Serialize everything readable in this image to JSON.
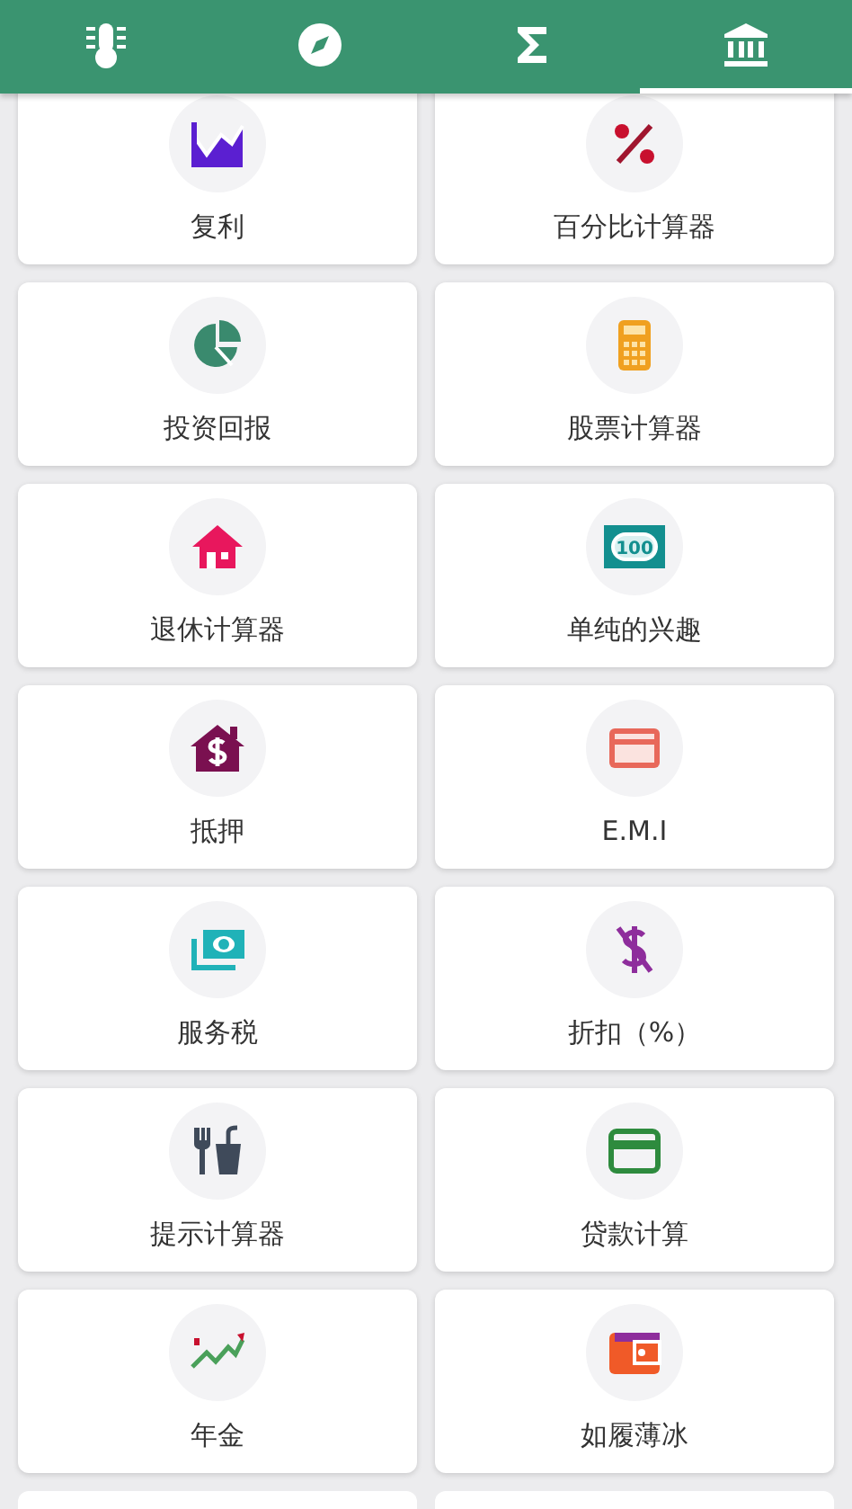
{
  "tabs": [
    {
      "kind": "thermometer",
      "selected": false
    },
    {
      "kind": "compass",
      "selected": false
    },
    {
      "kind": "sigma",
      "selected": false
    },
    {
      "kind": "bank",
      "selected": true
    }
  ],
  "calculators": [
    {
      "label": "复利",
      "kind": "area-chart"
    },
    {
      "label": "百分比计算器",
      "kind": "percent"
    },
    {
      "label": "投资回报",
      "kind": "pie"
    },
    {
      "label": "股票计算器",
      "kind": "calculator"
    },
    {
      "label": "退休计算器",
      "kind": "house"
    },
    {
      "label": "单纯的兴趣",
      "kind": "banknote"
    },
    {
      "label": "抵押",
      "kind": "house-dollar"
    },
    {
      "label": "E.M.I",
      "kind": "card-salmon"
    },
    {
      "label": "服务税",
      "kind": "money-stack"
    },
    {
      "label": "折扣（%）",
      "kind": "money-off"
    },
    {
      "label": "提示计算器",
      "kind": "fork-cup"
    },
    {
      "label": "贷款计算",
      "kind": "card-green"
    },
    {
      "label": "年金",
      "kind": "trend"
    },
    {
      "label": "如履薄冰",
      "kind": "wallet"
    }
  ],
  "banknote_icon_text": "100"
}
